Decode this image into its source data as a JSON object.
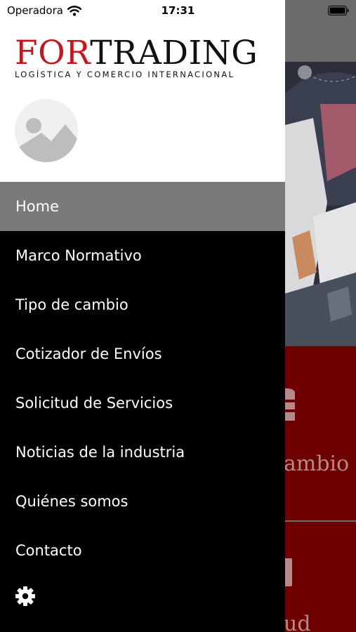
{
  "status_bar": {
    "carrier": "Operadora",
    "time": "17:31"
  },
  "brand": {
    "name_red": "FOR",
    "name_dark": "TRADING",
    "tagline": "LOGÍSTICA Y COMERCIO INTERNACIONAL"
  },
  "menu": {
    "items": [
      {
        "label": "Home",
        "active": true
      },
      {
        "label": "Marco Normativo"
      },
      {
        "label": "Tipo de cambio"
      },
      {
        "label": "Cotizador de Envíos"
      },
      {
        "label": "Solicitud de Servicios"
      },
      {
        "label": "Noticias de la industria"
      },
      {
        "label": "Quiénes somos"
      },
      {
        "label": "Contacto"
      }
    ]
  },
  "background": {
    "card1_text": "ambio",
    "card2_text": "ud"
  },
  "colors": {
    "brand_red": "#c8141b",
    "card_red": "#6e0000",
    "active_item": "#7a7a7a"
  },
  "icons": [
    "wifi-icon",
    "battery-icon",
    "avatar-placeholder-icon",
    "gear-icon",
    "coins-icon",
    "clipboard-icon"
  ]
}
